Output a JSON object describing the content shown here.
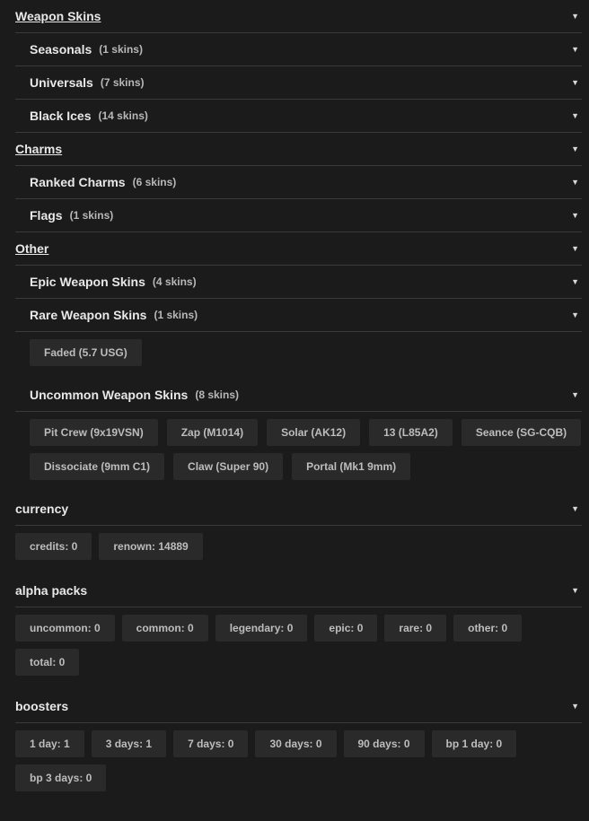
{
  "weapon_skins": {
    "title": "Weapon Skins",
    "groups": [
      {
        "label": "Seasonals",
        "count": "(1 skins)"
      },
      {
        "label": "Universals",
        "count": "(7 skins)"
      },
      {
        "label": "Black Ices",
        "count": "(14 skins)"
      }
    ]
  },
  "charms": {
    "title": "Charms",
    "groups": [
      {
        "label": "Ranked Charms",
        "count": "(6 skins)"
      },
      {
        "label": "Flags",
        "count": "(1 skins)"
      }
    ]
  },
  "other": {
    "title": "Other",
    "epic": {
      "label": "Epic Weapon Skins",
      "count": "(4 skins)"
    },
    "rare": {
      "label": "Rare Weapon Skins",
      "count": "(1 skins)",
      "items": [
        "Faded (5.7 USG)"
      ]
    },
    "uncommon": {
      "label": "Uncommon Weapon Skins",
      "count": "(8 skins)",
      "items": [
        "Pit Crew (9x19VSN)",
        "Zap (M1014)",
        "Solar (AK12)",
        "13 (L85A2)",
        "Seance (SG-CQB)",
        "Dissociate (9mm C1)",
        "Claw (Super 90)",
        "Portal (Mk1 9mm)"
      ]
    }
  },
  "currency": {
    "title": "currency",
    "items": [
      "credits: 0",
      "renown: 14889"
    ]
  },
  "alpha_packs": {
    "title": "alpha packs",
    "items": [
      "uncommon: 0",
      "common: 0",
      "legendary: 0",
      "epic: 0",
      "rare: 0",
      "other: 0",
      "total: 0"
    ]
  },
  "boosters": {
    "title": "boosters",
    "items": [
      "1 day: 1",
      "3 days: 1",
      "7 days: 0",
      "30 days: 0",
      "90 days: 0",
      "bp 1 day: 0",
      "bp 3 days: 0"
    ]
  },
  "icons": {
    "caret": "caret-down-icon"
  }
}
